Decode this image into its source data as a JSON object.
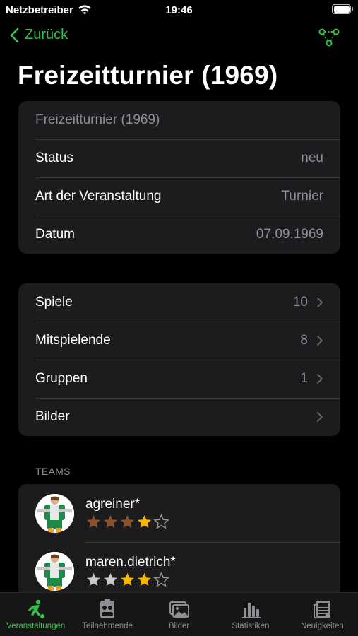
{
  "status_bar": {
    "carrier": "Netzbetreiber",
    "time": "19:46"
  },
  "nav": {
    "back_label": "Zurück",
    "accent_color": "#34c24a"
  },
  "page": {
    "title": "Freizeitturnier (1969)"
  },
  "info_card": {
    "header": "Freizeitturnier (1969)",
    "rows": [
      {
        "label": "Status",
        "value": "neu"
      },
      {
        "label": "Art der Veranstaltung",
        "value": "Turnier"
      },
      {
        "label": "Datum",
        "value": "07.09.1969"
      }
    ]
  },
  "links_card": {
    "rows": [
      {
        "label": "Spiele",
        "value": "10"
      },
      {
        "label": "Mitspielende",
        "value": "8"
      },
      {
        "label": "Gruppen",
        "value": "1"
      },
      {
        "label": "Bilder",
        "value": ""
      }
    ]
  },
  "teams": {
    "section_title": "TEAMS",
    "items": [
      {
        "name": "agreiner*",
        "stars": [
          "bronze",
          "bronze",
          "bronze",
          "gold",
          "empty"
        ]
      },
      {
        "name": "maren.dietrich*",
        "stars": [
          "silver",
          "silver",
          "gold",
          "gold",
          "empty"
        ]
      }
    ]
  },
  "tab_bar": {
    "tabs": [
      {
        "label": "Veranstaltungen",
        "icon": "soccer-player-icon",
        "active": true
      },
      {
        "label": "Teilnehmende",
        "icon": "person-card-icon",
        "active": false
      },
      {
        "label": "Bilder",
        "icon": "photos-icon",
        "active": false
      },
      {
        "label": "Statistiken",
        "icon": "bar-chart-icon",
        "active": false
      },
      {
        "label": "Neuigkeiten",
        "icon": "newspaper-icon",
        "active": false
      }
    ]
  }
}
